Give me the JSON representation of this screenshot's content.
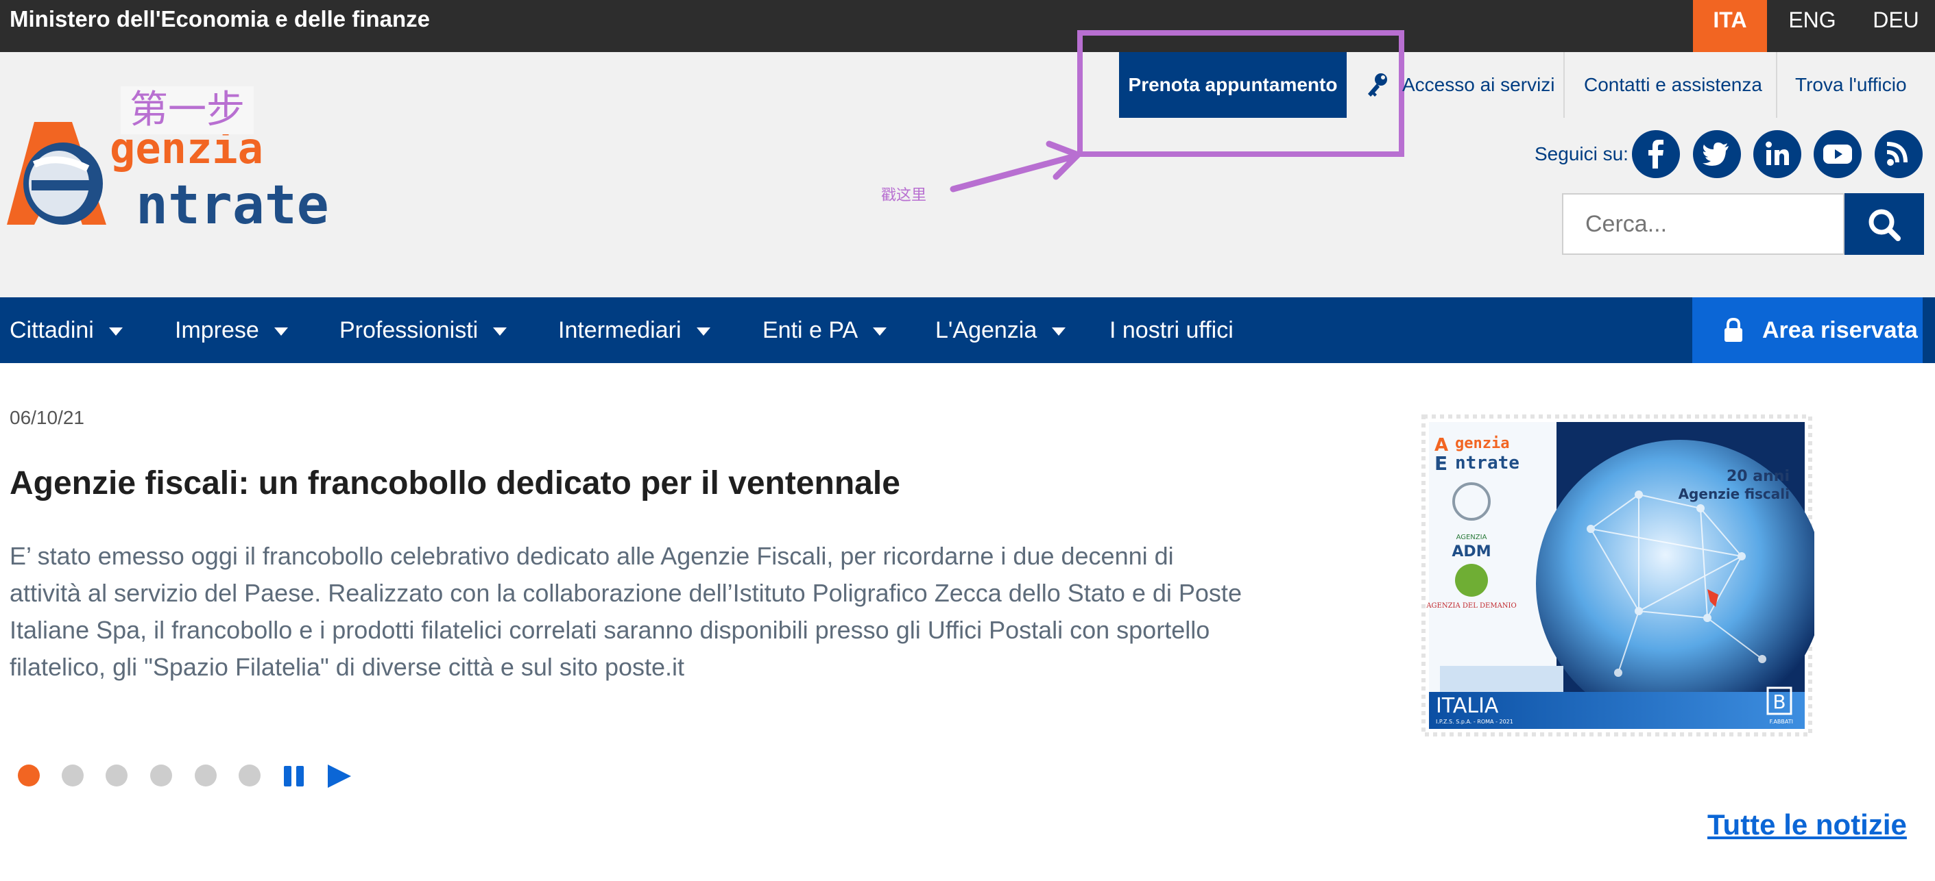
{
  "topbar": {
    "ministry": "Ministero dell'Economia e delle finanze",
    "languages": [
      "ITA",
      "ENG",
      "DEU"
    ],
    "active_language": "ITA"
  },
  "logo": {
    "line1": "genzia",
    "line2": "ntrate"
  },
  "annotations": {
    "step": "第一步",
    "note": "戳这里"
  },
  "header": {
    "prenota_label": "Prenota appuntamento",
    "links": [
      "Accesso ai servizi",
      "Contatti e assistenza",
      "Trova l'ufficio"
    ],
    "seguici": "Seguici su:",
    "social_icons": [
      "facebook-icon",
      "twitter-icon",
      "linkedin-icon",
      "youtube-icon",
      "rss-icon"
    ],
    "search_placeholder": "Cerca..."
  },
  "nav": {
    "items": [
      {
        "label": "Cittadini",
        "dropdown": true
      },
      {
        "label": "Imprese",
        "dropdown": true
      },
      {
        "label": "Professionisti",
        "dropdown": true
      },
      {
        "label": "Intermediari",
        "dropdown": true
      },
      {
        "label": "Enti e PA",
        "dropdown": true
      },
      {
        "label": "L'Agenzia",
        "dropdown": true
      },
      {
        "label": "I nostri uffici",
        "dropdown": false
      }
    ],
    "area_riservata": "Area riservata"
  },
  "news": {
    "date": "06/10/21",
    "title": "Agenzie fiscali: un francobollo dedicato per il ventennale",
    "body": "E’ stato emesso oggi il francobollo celebrativo dedicato alle Agenzie Fiscali, per ricordarne i due decenni di attività al servizio del Paese. Realizzato con la collaborazione dell’Istituto Poligrafico Zecca dello Stato e di Poste Italiane Spa, il francobollo e i prodotti filatelici correlati saranno disponibili presso gli Uffici Postali con sportello filatelico, gli \"Spazio Filatelia\" di diverse città e sul sito poste.it"
  },
  "stamp": {
    "logo_line1": "genzia",
    "logo_line2": "ntrate",
    "anniversary": "20 anni",
    "subtitle": "Agenzie fiscali",
    "adm": "ADM",
    "agenzia_small": "AGENZIA",
    "demanio": "AGENZIA DEL DEMANIO",
    "country": "ITALIA",
    "printer": "I.P.Z.S. S.p.A. - ROMA - 2021",
    "artist": "F.ABBATI",
    "value_letter": "B"
  },
  "carousel": {
    "slides": 6,
    "active": 0
  },
  "colors": {
    "brand_blue": "#003d82",
    "accent_orange": "#f26522",
    "link_blue": "#0b66d6",
    "annotation": "#b86fd1"
  },
  "all_news_label": "Tutte le notizie"
}
